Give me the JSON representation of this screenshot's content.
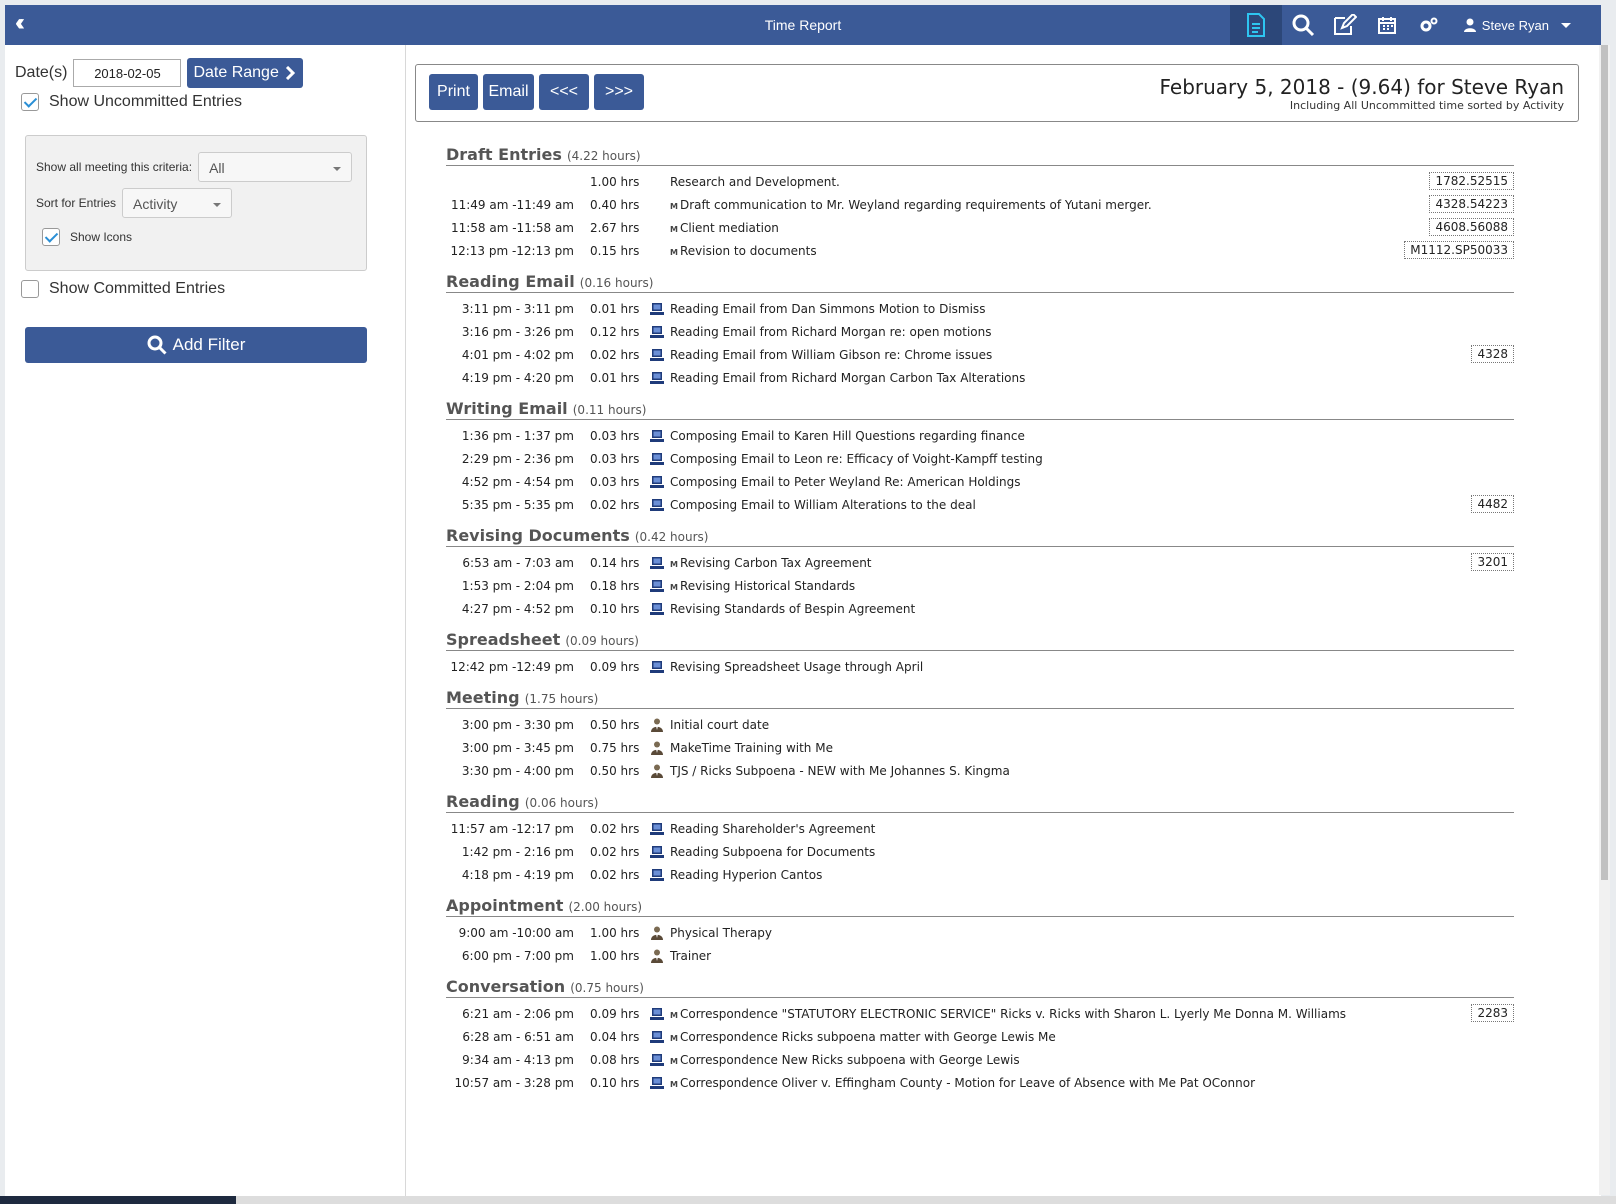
{
  "topbar": {
    "title": "Time Report",
    "user": "Steve Ryan",
    "icons": [
      "report-icon",
      "search-icon",
      "edit-icon",
      "calendar-icon",
      "settings-icon",
      "user-icon"
    ]
  },
  "left": {
    "date_label": "Date(s)",
    "date_value": "2018-02-05",
    "date_range_label": "Date Range",
    "show_uncommitted": "Show Uncommitted Entries",
    "criteria_label": "Show all meeting this criteria:",
    "criteria_value": "All",
    "sort_label": "Sort for Entries",
    "sort_value": "Activity",
    "show_icons": "Show Icons",
    "show_committed": "Show Committed Entries",
    "add_filter": "Add Filter"
  },
  "header": {
    "print": "Print",
    "email": "Email",
    "prev": "<<<",
    "next": ">>>",
    "title": "February 5, 2018 - (9.64) for Steve Ryan",
    "subtitle": "Including All Uncommitted time sorted by Activity"
  },
  "sections": [
    {
      "name": "Draft Entries",
      "hours": "(4.22 hours)",
      "entries": [
        {
          "time": "",
          "hrs": "1.00 hrs",
          "icon": "",
          "m": false,
          "desc": "Research and Development.",
          "matter": "1782.52515"
        },
        {
          "time": "11:49 am -11:49 am",
          "hrs": "0.40 hrs",
          "icon": "",
          "m": true,
          "desc": "Draft communication to Mr. Weyland regarding requirements of Yutani merger.",
          "matter": "4328.54223"
        },
        {
          "time": "11:58 am -11:58 am",
          "hrs": "2.67 hrs",
          "icon": "",
          "m": true,
          "desc": "Client mediation",
          "matter": "4608.56088"
        },
        {
          "time": "12:13 pm -12:13 pm",
          "hrs": "0.15 hrs",
          "icon": "",
          "m": true,
          "desc": "Revision to documents",
          "matter": "M1112.SP50033"
        }
      ]
    },
    {
      "name": "Reading Email",
      "hours": "(0.16 hours)",
      "entries": [
        {
          "time": "3:11 pm -  3:11 pm",
          "hrs": "0.01 hrs",
          "icon": "computer",
          "m": false,
          "desc": "Reading Email from Dan Simmons Motion to Dismiss",
          "matter": ""
        },
        {
          "time": "3:16 pm -  3:26 pm",
          "hrs": "0.12 hrs",
          "icon": "computer",
          "m": false,
          "desc": "Reading Email from Richard Morgan re: open motions",
          "matter": ""
        },
        {
          "time": "4:01 pm -  4:02 pm",
          "hrs": "0.02 hrs",
          "icon": "computer",
          "m": false,
          "desc": "Reading Email from William Gibson re: Chrome issues",
          "matter": "4328"
        },
        {
          "time": "4:19 pm -  4:20 pm",
          "hrs": "0.01 hrs",
          "icon": "computer",
          "m": false,
          "desc": "Reading Email from Richard Morgan Carbon Tax Alterations",
          "matter": ""
        }
      ]
    },
    {
      "name": "Writing Email",
      "hours": "(0.11 hours)",
      "entries": [
        {
          "time": "1:36 pm -  1:37 pm",
          "hrs": "0.03 hrs",
          "icon": "computer",
          "m": false,
          "desc": "Composing Email to Karen Hill Questions regarding finance",
          "matter": ""
        },
        {
          "time": "2:29 pm -  2:36 pm",
          "hrs": "0.03 hrs",
          "icon": "computer",
          "m": false,
          "desc": "Composing Email to Leon re: Efficacy of Voight-Kampff testing",
          "matter": ""
        },
        {
          "time": "4:52 pm -  4:54 pm",
          "hrs": "0.03 hrs",
          "icon": "computer",
          "m": false,
          "desc": "Composing Email to Peter Weyland Re: American Holdings",
          "matter": ""
        },
        {
          "time": "5:35 pm -  5:35 pm",
          "hrs": "0.02 hrs",
          "icon": "computer",
          "m": false,
          "desc": "Composing Email to William Alterations to the deal",
          "matter": "4482"
        }
      ]
    },
    {
      "name": "Revising Documents",
      "hours": "(0.42 hours)",
      "entries": [
        {
          "time": "6:53 am -  7:03 am",
          "hrs": "0.14 hrs",
          "icon": "computer",
          "m": true,
          "desc": "Revising Carbon Tax Agreement",
          "matter": "3201"
        },
        {
          "time": "1:53 pm -  2:04 pm",
          "hrs": "0.18 hrs",
          "icon": "computer",
          "m": true,
          "desc": "Revising Historical Standards",
          "matter": ""
        },
        {
          "time": "4:27 pm -  4:52 pm",
          "hrs": "0.10 hrs",
          "icon": "computer",
          "m": false,
          "desc": "Revising Standards of Bespin Agreement",
          "matter": ""
        }
      ]
    },
    {
      "name": "Spreadsheet",
      "hours": "(0.09 hours)",
      "entries": [
        {
          "time": "12:42 pm -12:49 pm",
          "hrs": "0.09 hrs",
          "icon": "computer",
          "m": false,
          "desc": "Revising Spreadsheet Usage through April",
          "matter": ""
        }
      ]
    },
    {
      "name": "Meeting",
      "hours": "(1.75 hours)",
      "entries": [
        {
          "time": "3:00 pm -  3:30 pm",
          "hrs": "0.50 hrs",
          "icon": "person",
          "m": false,
          "desc": "Initial court date",
          "matter": ""
        },
        {
          "time": "3:00 pm -  3:45 pm",
          "hrs": "0.75 hrs",
          "icon": "person",
          "m": false,
          "desc": "MakeTime Training with Me",
          "matter": ""
        },
        {
          "time": "3:30 pm -  4:00 pm",
          "hrs": "0.50 hrs",
          "icon": "person",
          "m": false,
          "desc": "TJS / Ricks Subpoena - NEW with Me Johannes S. Kingma",
          "matter": ""
        }
      ]
    },
    {
      "name": "Reading",
      "hours": "(0.06 hours)",
      "entries": [
        {
          "time": "11:57 am -12:17 pm",
          "hrs": "0.02 hrs",
          "icon": "computer",
          "m": false,
          "desc": "Reading Shareholder's Agreement",
          "matter": ""
        },
        {
          "time": "1:42 pm -  2:16 pm",
          "hrs": "0.02 hrs",
          "icon": "computer",
          "m": false,
          "desc": "Reading Subpoena for Documents",
          "matter": ""
        },
        {
          "time": "4:18 pm -  4:19 pm",
          "hrs": "0.02 hrs",
          "icon": "computer",
          "m": false,
          "desc": "Reading Hyperion Cantos",
          "matter": ""
        }
      ]
    },
    {
      "name": "Appointment",
      "hours": "(2.00 hours)",
      "entries": [
        {
          "time": "9:00 am -10:00 am",
          "hrs": "1.00 hrs",
          "icon": "person",
          "m": false,
          "desc": "Physical Therapy",
          "matter": ""
        },
        {
          "time": "6:00 pm -  7:00 pm",
          "hrs": "1.00 hrs",
          "icon": "person",
          "m": false,
          "desc": "Trainer",
          "matter": ""
        }
      ]
    },
    {
      "name": "Conversation",
      "hours": "(0.75 hours)",
      "entries": [
        {
          "time": "6:21 am -  2:06 pm",
          "hrs": "0.09 hrs",
          "icon": "computer",
          "m": true,
          "desc": "Correspondence \"STATUTORY ELECTRONIC SERVICE\" Ricks v. Ricks with Sharon L. Lyerly Me Donna M. Williams",
          "matter": "2283"
        },
        {
          "time": "6:28 am -  6:51 am",
          "hrs": "0.04 hrs",
          "icon": "computer",
          "m": true,
          "desc": "Correspondence Ricks subpoena matter with George Lewis Me",
          "matter": ""
        },
        {
          "time": "9:34 am -  4:13 pm",
          "hrs": "0.08 hrs",
          "icon": "computer",
          "m": true,
          "desc": "Correspondence New Ricks subpoena with George Lewis",
          "matter": ""
        },
        {
          "time": "10:57 am -  3:28 pm",
          "hrs": "0.10 hrs",
          "icon": "computer",
          "m": true,
          "desc": "Correspondence Oliver v. Effingham County - Motion for Leave of Absence with Me Pat OConnor",
          "matter": ""
        }
      ]
    }
  ]
}
